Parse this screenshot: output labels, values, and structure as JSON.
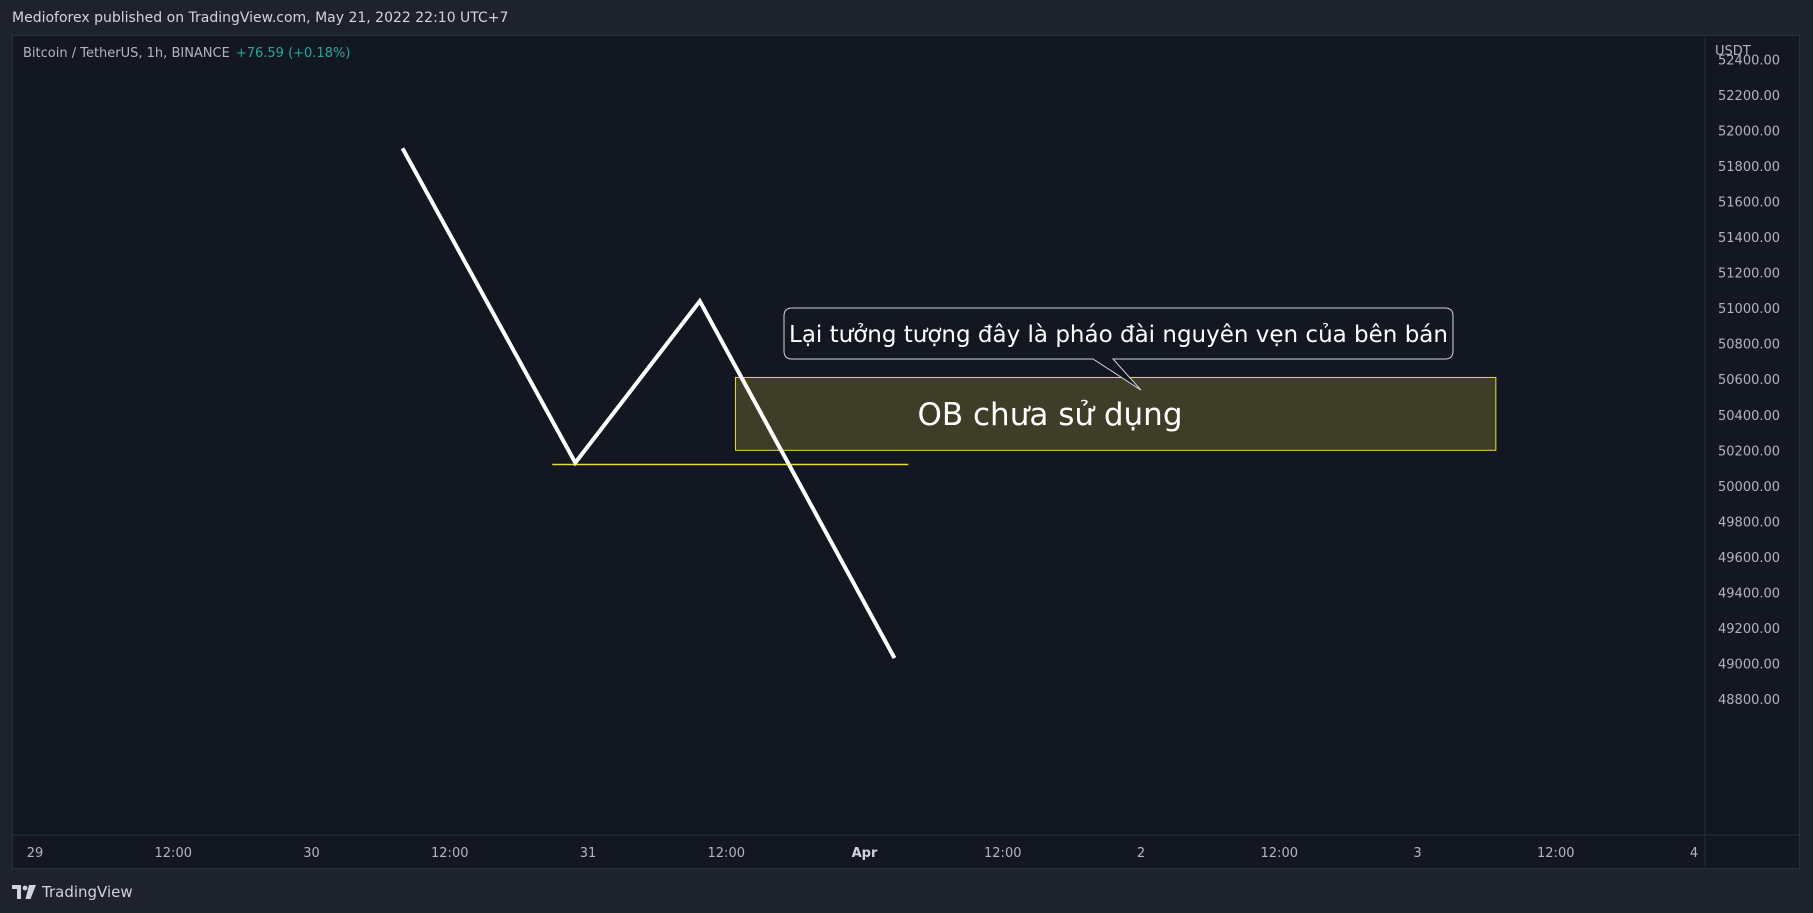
{
  "header": {
    "caption": "Medioforex published on TradingView.com, May 21, 2022 22:10 UTC+7"
  },
  "legend": {
    "symbol": "Bitcoin / TetherUS, 1h, BINANCE",
    "change": "+76.59 (+0.18%)"
  },
  "footer": {
    "brand": "TradingView",
    "logo_icon": "tradingview-logo-icon"
  },
  "colors": {
    "background": "#131722",
    "grid_border": "#2a2e39",
    "text": "#b2b5be",
    "change_positive": "#26a69a",
    "price_line": "#ffffff",
    "ob_zone_fill": "#3f3f29",
    "ob_zone_border": "#e6dd3b"
  },
  "chart_data": {
    "type": "line",
    "ylabel": "USDT",
    "y_ticks": [
      "52400.00",
      "52200.00",
      "52000.00",
      "51800.00",
      "51600.00",
      "51400.00",
      "51200.00",
      "51000.00",
      "50800.00",
      "50600.00",
      "50400.00",
      "50200.00",
      "50000.00",
      "49800.00",
      "49600.00",
      "49400.00",
      "49200.00",
      "49000.00",
      "48800.00"
    ],
    "ylim": [
      48700,
      52450
    ],
    "x_ticks": [
      "29",
      "12:00",
      "30",
      "12:00",
      "31",
      "12:00",
      "Apr",
      "12:00",
      "2",
      "12:00",
      "3",
      "12:00",
      "4"
    ],
    "x_ticks_hours": [
      0,
      12,
      24,
      36,
      48,
      60,
      72,
      84,
      96,
      108,
      120,
      132,
      144
    ],
    "xlim_hours": [
      -1,
      145
    ],
    "series": [
      {
        "x_hours": [
          31.9,
          46.9,
          57.7,
          74.6
        ],
        "values": [
          51900,
          50130,
          51040,
          49030
        ]
      }
    ],
    "annotations": {
      "support_line": {
        "price": 50120,
        "x_start_hours": 44.9,
        "x_end_hours": 75.8
      },
      "ob_zone": {
        "label": "OB chưa sử dụng",
        "price_top": 50610,
        "price_bottom": 50200,
        "x_start_hours": 60.8,
        "x_end_hours": 126.8
      },
      "callout": {
        "text": "Lại tưởng tượng đây là pháo đài nguyên vẹn của bên bán",
        "anchor_price": 50460,
        "anchor_x_hours": 96
      }
    }
  }
}
